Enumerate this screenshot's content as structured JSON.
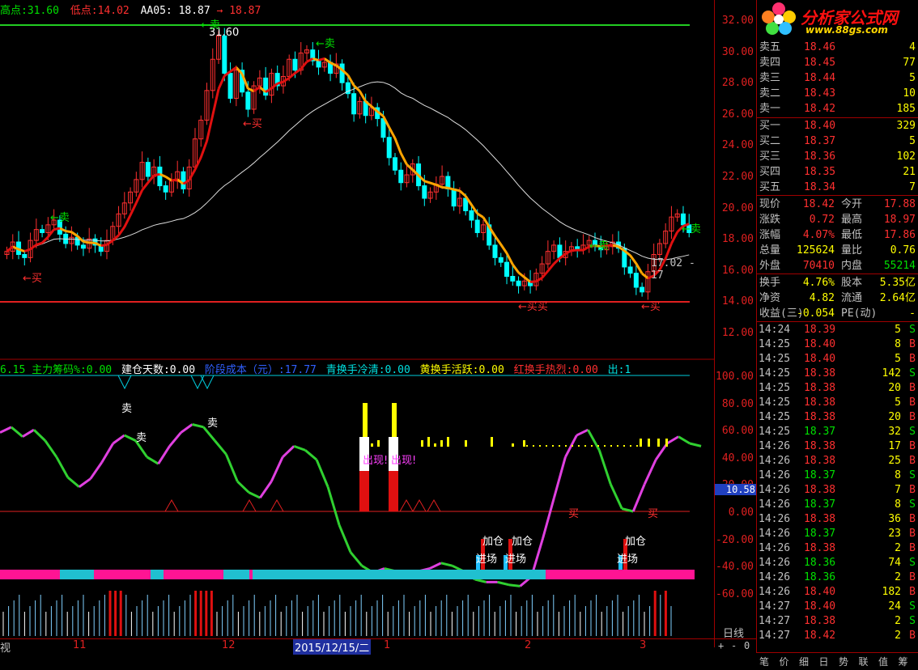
{
  "header": {
    "high_label": "高点:",
    "high_value": "31.60",
    "low_label": "低点:",
    "low_value": "14.02",
    "aa_label": "AA05:",
    "aa_value1": "18.87",
    "aa_sep": "→",
    "aa_value2": "18.87"
  },
  "indicator_header": {
    "prefix": "6.15",
    "main_label": "主力筹码%:",
    "main_value": "0.00",
    "build_label": "建仓天数:",
    "build_value": "0.00",
    "cost_label": "阶段成本（元）:",
    "cost_value": "17.77",
    "cold_label": "青换手冷清:",
    "cold_value": "0.00",
    "active_label": "黄换手活跃:",
    "active_value": "0.00",
    "hot_label": "红换手热烈:",
    "hot_value": "0.00",
    "exit_label": "出:",
    "exit_value": "1"
  },
  "price_axis": [
    "32.00",
    "30.00",
    "28.00",
    "26.00",
    "24.00",
    "22.00",
    "20.00",
    "18.00",
    "16.00",
    "14.00",
    "12.00"
  ],
  "ind_axis": [
    "100.00",
    "80.00",
    "60.00",
    "40.00",
    "20.00",
    "0.00",
    "-20.00",
    "-40.00",
    "-60.00"
  ],
  "ind_current": "10.58",
  "annotations": {
    "high_mark": "31.60",
    "low_mark": "17.02 - 17",
    "sell": "卖",
    "buy": "买",
    "sell_arrow": "←卖",
    "buy_arrow": "←买",
    "buy_buy": "←买买",
    "add": "加仓",
    "enter": "进场",
    "appear": "出现!"
  },
  "x_axis": {
    "m11": "11",
    "m12": "12",
    "date_box": "2015/12/15/二",
    "m1": "1",
    "m2": "2",
    "m3": "3",
    "period": "日线",
    "left_tag": "视"
  },
  "zoom": {
    "plus": "+",
    "minus": "-",
    "zero": "0"
  },
  "logo": {
    "text": "分析家公式网",
    "url": "www.88gs.com"
  },
  "order_book": {
    "asks": [
      {
        "label": "卖五",
        "price": "18.46",
        "vol": "4"
      },
      {
        "label": "卖四",
        "price": "18.45",
        "vol": "77"
      },
      {
        "label": "卖三",
        "price": "18.44",
        "vol": "5"
      },
      {
        "label": "卖二",
        "price": "18.43",
        "vol": "10"
      },
      {
        "label": "卖一",
        "price": "18.42",
        "vol": "185"
      }
    ],
    "bids": [
      {
        "label": "买一",
        "price": "18.40",
        "vol": "329"
      },
      {
        "label": "买二",
        "price": "18.37",
        "vol": "5"
      },
      {
        "label": "买三",
        "price": "18.36",
        "vol": "102"
      },
      {
        "label": "买四",
        "price": "18.35",
        "vol": "21"
      },
      {
        "label": "买五",
        "price": "18.34",
        "vol": "7"
      }
    ]
  },
  "stats": {
    "price_label": "现价",
    "price": "18.42",
    "open_label": "今开",
    "open": "17.88",
    "chg_label": "涨跌",
    "chg": "0.72",
    "high_label": "最高",
    "high": "18.97",
    "pct_label": "涨幅",
    "pct": "4.07%",
    "low_label": "最低",
    "low": "17.86",
    "vol_label": "总量",
    "vol": "125624",
    "ratio_label": "量比",
    "ratio": "0.76",
    "out_label": "外盘",
    "out": "70410",
    "in_label": "内盘",
    "in": "55214",
    "turn_label": "换手",
    "turn": "4.76%",
    "cap_label": "股本",
    "cap": "5.35亿",
    "nav_label": "净资",
    "nav": "4.82",
    "float_label": "流通",
    "float": "2.64亿",
    "eps_label": "收益(三)",
    "eps": "-0.054",
    "pe_label": "PE(动)",
    "pe": "-"
  },
  "ticks": [
    {
      "t": "14:24",
      "p": "18.39",
      "v": "5",
      "s": "S"
    },
    {
      "t": "14:25",
      "p": "18.40",
      "v": "8",
      "s": "B"
    },
    {
      "t": "14:25",
      "p": "18.40",
      "v": "5",
      "s": "B"
    },
    {
      "t": "14:25",
      "p": "18.38",
      "v": "142",
      "s": "S"
    },
    {
      "t": "14:25",
      "p": "18.38",
      "v": "20",
      "s": "B"
    },
    {
      "t": "14:25",
      "p": "18.38",
      "v": "5",
      "s": "B"
    },
    {
      "t": "14:25",
      "p": "18.38",
      "v": "20",
      "s": "B"
    },
    {
      "t": "14:25",
      "p": "18.37",
      "v": "32",
      "s": "S"
    },
    {
      "t": "14:26",
      "p": "18.38",
      "v": "17",
      "s": "B"
    },
    {
      "t": "14:26",
      "p": "18.38",
      "v": "25",
      "s": "B"
    },
    {
      "t": "14:26",
      "p": "18.37",
      "v": "8",
      "s": "S"
    },
    {
      "t": "14:26",
      "p": "18.38",
      "v": "7",
      "s": "B"
    },
    {
      "t": "14:26",
      "p": "18.37",
      "v": "8",
      "s": "S"
    },
    {
      "t": "14:26",
      "p": "18.38",
      "v": "36",
      "s": "B"
    },
    {
      "t": "14:26",
      "p": "18.37",
      "v": "23",
      "s": "B"
    },
    {
      "t": "14:26",
      "p": "18.38",
      "v": "2",
      "s": "B"
    },
    {
      "t": "14:26",
      "p": "18.36",
      "v": "74",
      "s": "S"
    },
    {
      "t": "14:26",
      "p": "18.36",
      "v": "2",
      "s": "B"
    },
    {
      "t": "14:26",
      "p": "18.40",
      "v": "182",
      "s": "B"
    },
    {
      "t": "14:27",
      "p": "18.40",
      "v": "24",
      "s": "S"
    },
    {
      "t": "14:27",
      "p": "18.38",
      "v": "2",
      "s": "S"
    },
    {
      "t": "14:27",
      "p": "18.42",
      "v": "2",
      "s": "B"
    }
  ],
  "tabs": [
    "笔",
    "价",
    "细",
    "日",
    "势",
    "联",
    "值",
    "筹"
  ],
  "colors": {
    "up": "#ff3030",
    "down": "#00ffff",
    "grid": "#a00000",
    "ma_fast": "#ffa500",
    "ma_slow": "#ffffff"
  }
}
